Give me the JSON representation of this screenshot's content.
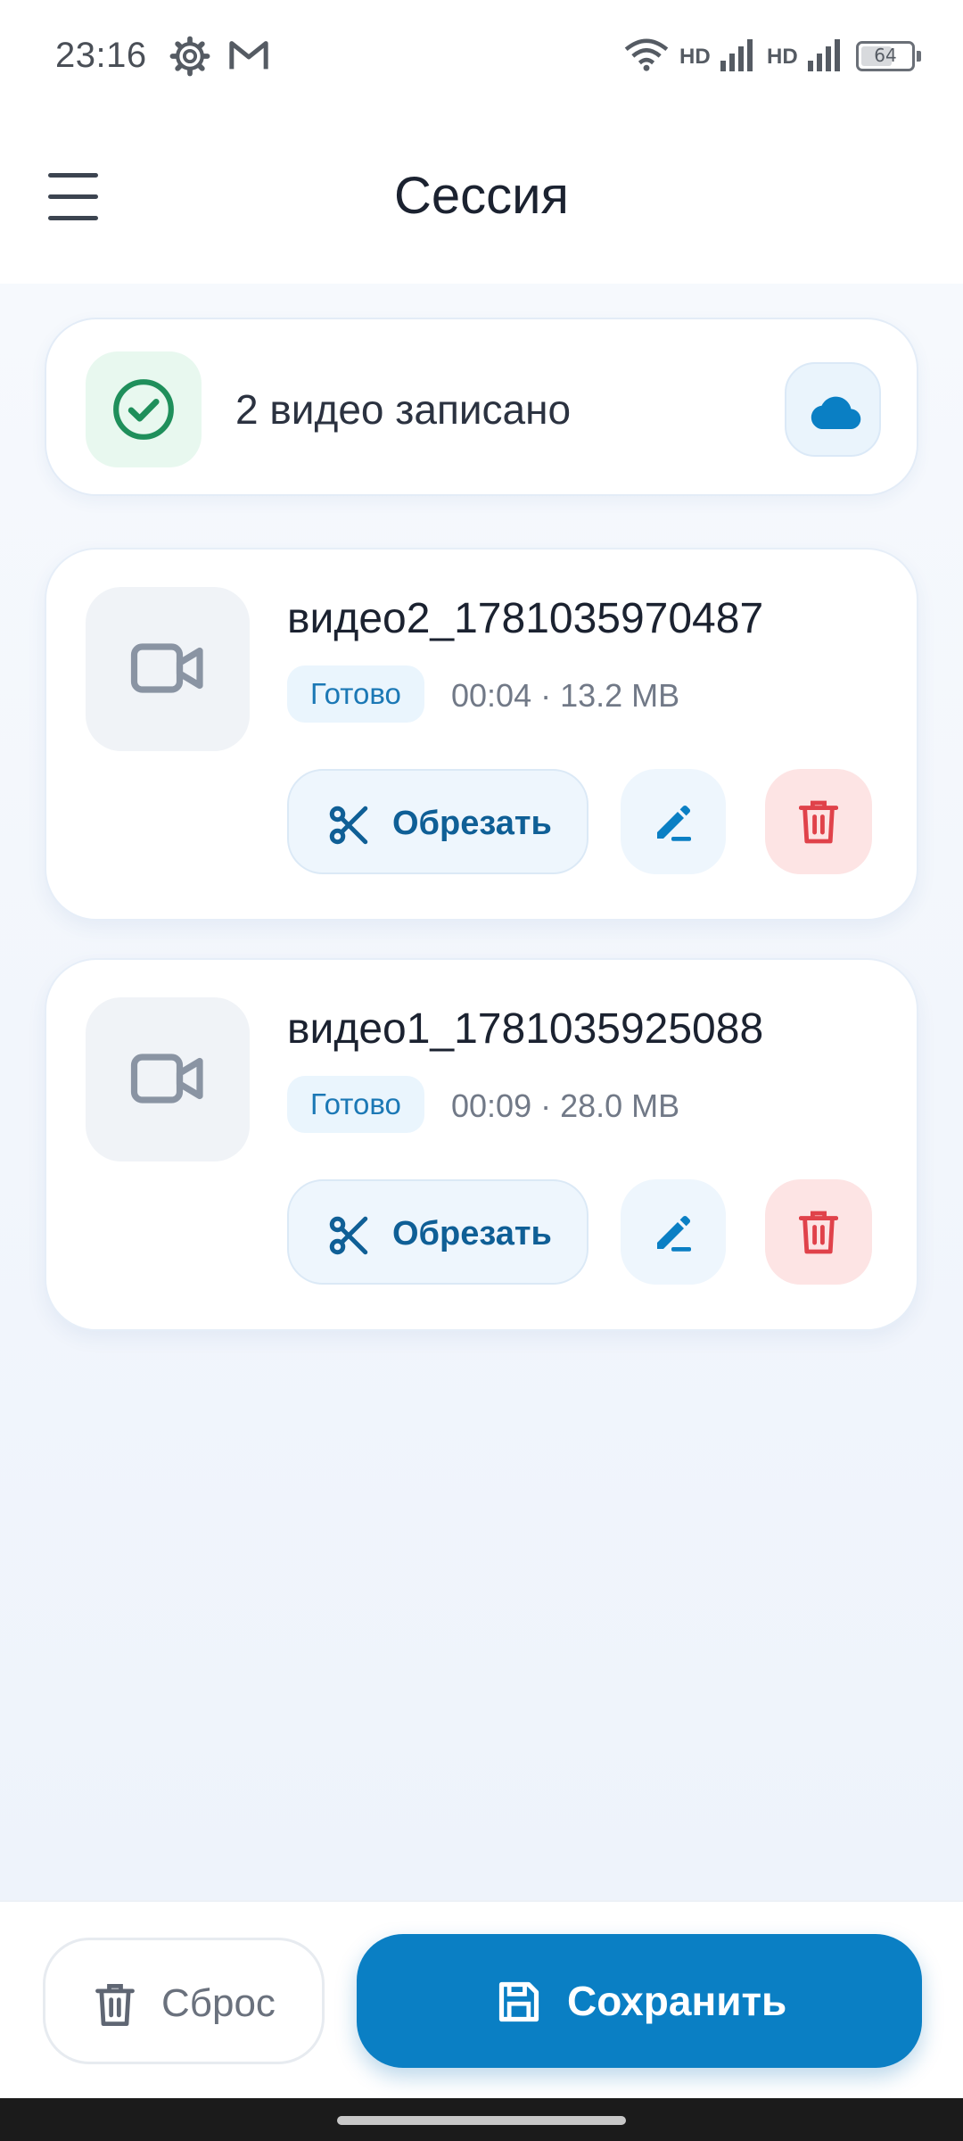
{
  "status_bar": {
    "time": "23:16",
    "network_1": "HD",
    "network_2": "HD",
    "battery": "64",
    "icons": [
      "gear-icon",
      "gmail-icon",
      "wifi-icon",
      "signal-icon",
      "signal-icon",
      "battery-icon"
    ]
  },
  "app_bar": {
    "title": "Сессия",
    "menu_icon": "hamburger-menu-icon"
  },
  "summary": {
    "text": "2 видео записано",
    "status_icon": "check-circle-icon",
    "action_icon": "cloud-icon"
  },
  "videos": [
    {
      "name": "видео2_1781035970487",
      "status": "Готово",
      "meta": "00:04 · 13.2 MB",
      "trim_label": "Обрезать"
    },
    {
      "name": "видео1_1781035925088",
      "status": "Готово",
      "meta": "00:09 · 28.0 MB",
      "trim_label": "Обрезать"
    }
  ],
  "actions": {
    "reset_label": "Сброс",
    "save_label": "Сохранить"
  },
  "colors": {
    "accent": "#0a7fc4",
    "success": "#1f8f5b",
    "danger": "#e0424a",
    "chip_text": "#1b78b5"
  }
}
